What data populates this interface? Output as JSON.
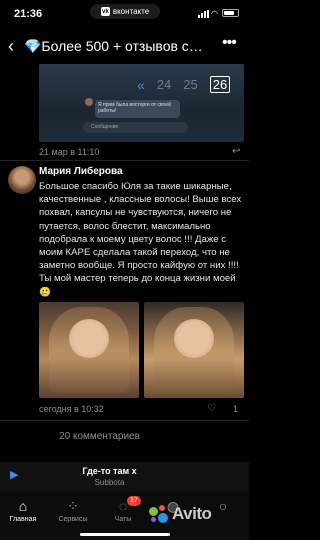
{
  "status_bar": {
    "time": "21:36",
    "app_pill": "вконтакте",
    "battery_level": 0.8
  },
  "header": {
    "title": "💎Более  500 + отзывов с…"
  },
  "embedded_image": {
    "bubble_text": "Я прям была восторге от своей работы!",
    "input_placeholder": "Сообщение",
    "pager": [
      "«",
      "24",
      "25",
      "26"
    ]
  },
  "post": {
    "date": "21 мар в 11:10"
  },
  "comment": {
    "author": "Мария Либерова",
    "text": "Большое спасибо Юля за такие шикарные, качественные , классные волосы! Выше всех похвал, капсулы не чувствуются, ничего не путается, волос блестит, максимально подобрала к моему цвету волос !!! Даже с моим КАРЕ сделала такой переход, что не заметно вообще. Я просто кайфую от них !!!! Ты мой мастер теперь до конца жизни моей 🥲",
    "date": "сегодня в 10:32",
    "likes": "1"
  },
  "comments_count": "20 комментариев",
  "player": {
    "song": "Где-то там x",
    "artist": "Subbota"
  },
  "tabbar": {
    "items": [
      {
        "label": "Главная",
        "icon": "home-icon"
      },
      {
        "label": "Сервисы",
        "icon": "services-icon"
      },
      {
        "label": "Чаты",
        "icon": "chat-icon",
        "badge": "17"
      },
      {
        "label": "",
        "icon": "friends-icon"
      },
      {
        "label": "",
        "icon": "profile-icon"
      }
    ]
  },
  "watermark": "Avito",
  "colors": {
    "accent": "#3a8ef6",
    "badge": "#ff3b30",
    "background": "#000000"
  }
}
